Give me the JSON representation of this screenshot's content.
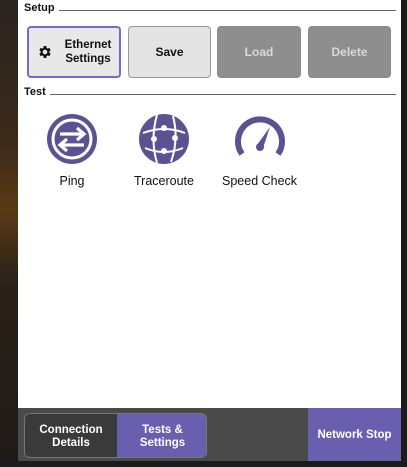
{
  "setup": {
    "title": "Setup",
    "ethernet_settings_label_line1": "Ethernet",
    "ethernet_settings_label_line2": "Settings",
    "save_label": "Save",
    "load_label": "Load",
    "delete_label": "Delete",
    "load_enabled": false,
    "delete_enabled": false
  },
  "test": {
    "title": "Test",
    "items": [
      {
        "label": "Ping",
        "icon": "ping-icon"
      },
      {
        "label": "Traceroute",
        "icon": "traceroute-icon"
      },
      {
        "label": "Speed Check",
        "icon": "speed-check-icon"
      }
    ]
  },
  "bottom_nav": {
    "connection_details_line1": "Connection",
    "connection_details_line2": "Details",
    "tests_settings_line1": "Tests &",
    "tests_settings_line2": "Settings",
    "active_tab": "Tests & Settings",
    "network_stop_label": "Network Stop"
  },
  "colors": {
    "accent": "#6a5fae",
    "icon": "#5a5293",
    "disabled_button": "#8e8e8e"
  }
}
